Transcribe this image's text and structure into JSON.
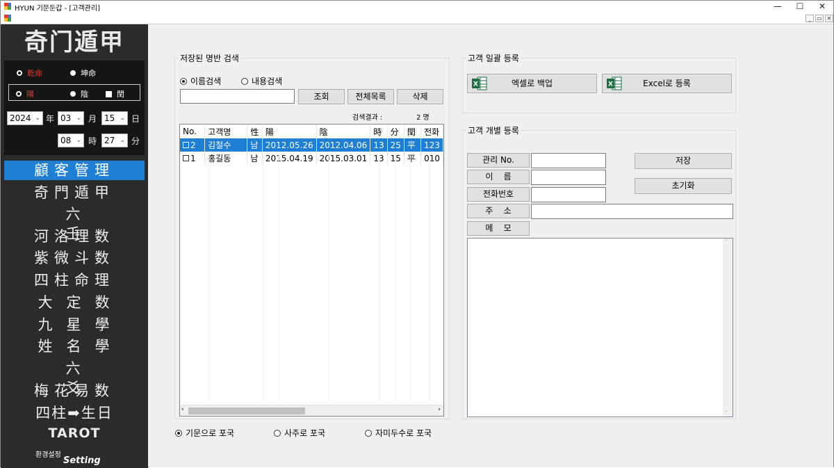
{
  "window": {
    "title": "HYUN 기문둔갑 - [고객관리]",
    "controls": [
      "—",
      "☐",
      "✕"
    ],
    "mdi_controls": [
      "_",
      "▭",
      "✕"
    ]
  },
  "sidebar": {
    "logo": "奇门遁甲",
    "gender_options": [
      "乾命",
      "坤命"
    ],
    "yinyang_options": [
      "陽",
      "陰"
    ],
    "leap_label": "閏",
    "year": "2024",
    "month": "03",
    "day": "15",
    "hour": "08",
    "minute": "27",
    "units": {
      "year": "年",
      "month": "月",
      "day": "日",
      "hour": "時",
      "minute": "分"
    },
    "menu": [
      "顧客管理",
      "奇門遁甲",
      "六壬",
      "河洛理数",
      "紫微斗数",
      "四柱命理",
      "大定数",
      "九星學",
      "姓名學",
      "六爻",
      "梅花易数",
      "四柱➡生日"
    ],
    "tarot": "TAROT",
    "setting_kr": "환경설정",
    "setting_en": "Setting"
  },
  "search": {
    "group_title": "저장된 명반 검색",
    "radio_name": "이름검색",
    "radio_content": "내용검색",
    "input_value": "",
    "btn_query": "조회",
    "btn_all": "전체목록",
    "btn_delete": "삭제",
    "result_label": "검색결과 :",
    "result_count": "2 명"
  },
  "table": {
    "columns": [
      "No.",
      "고객명",
      "性",
      "陽",
      "陰",
      "時",
      "分",
      "閏",
      "전화"
    ],
    "rows": [
      {
        "no": "2",
        "name": "김철수",
        "sex": "남",
        "yang": "2012.05.26",
        "yin": "2012.04.06",
        "hour": "13",
        "min": "25",
        "leap": "平",
        "phone": "123",
        "selected": true
      },
      {
        "no": "1",
        "name": "홍길동",
        "sex": "남",
        "yang": "2015.04.19",
        "yin": "2015.03.01",
        "hour": "13",
        "min": "15",
        "leap": "平",
        "phone": "010",
        "selected": false
      }
    ]
  },
  "bottom_radios": [
    "기문으로 포국",
    "사주로 포국",
    "자미두수로 포국"
  ],
  "bulk": {
    "group_title": "고객 일괄 등록",
    "btn_backup": "엑셀로 백업",
    "btn_register": "Excel로 등록"
  },
  "individual": {
    "group_title": "고객 개별 등록",
    "labels": {
      "mgmt_no": "관리 No.",
      "name": "이    름",
      "phone": "전화번호",
      "address": "주    소",
      "memo": "메    모"
    },
    "btn_save": "저장",
    "btn_reset": "초기화"
  },
  "colors": {
    "accent": "#1e7fd4",
    "sidebar": "#2b2b2b",
    "radio_red": "#e23b2e"
  }
}
